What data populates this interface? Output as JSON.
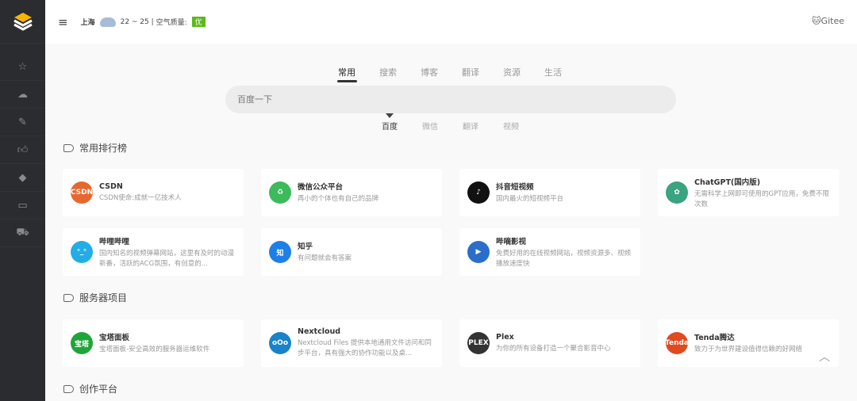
{
  "header": {
    "menu_icon": "hamburger-icon",
    "city": "上海",
    "weather_icon": "cloud-icon",
    "temp": "22 ~ 25",
    "sep": "|",
    "aq_label": "空气质量:",
    "aq_value": "优",
    "gitee": "🐱Gitee"
  },
  "sidebar": {
    "items": [
      "star-icon",
      "cloud-icon",
      "pencil-icon",
      "thumbs-up-icon",
      "diamond-icon",
      "monitor-icon",
      "truck-icon"
    ]
  },
  "tabs": [
    "常用",
    "搜索",
    "博客",
    "翻译",
    "资源",
    "生活"
  ],
  "search": {
    "placeholder": "百度一下"
  },
  "engines": [
    "百度",
    "微信",
    "翻译",
    "视频"
  ],
  "sections": [
    {
      "title": "常用排行榜",
      "cards": [
        {
          "title": "CSDN",
          "desc": "CSDN使命:成就一亿技术人",
          "icon": "CSDN",
          "color": "#e8672f"
        },
        {
          "title": "微信公众平台",
          "desc": "再小的个体也有自己的品牌",
          "icon": "♻",
          "color": "#3cba5c"
        },
        {
          "title": "抖音短视频",
          "desc": "国内最火的短视频平台",
          "icon": "♪",
          "color": "#111111"
        },
        {
          "title": "ChatGPT(国内版)",
          "desc": "无需科学上网即可使用的GPT应用，免费不限次数",
          "icon": "✿",
          "color": "#3aa37f"
        },
        {
          "title": "哔哩哔哩",
          "desc": "国内知名的视频弹幕网站，这里有及时的动漫新番，活跃的ACG氛围，有创意的...",
          "icon": "ᐢ_ᐢ",
          "color": "#23ade5"
        },
        {
          "title": "知乎",
          "desc": "有问题就会有答案",
          "icon": "知",
          "color": "#1e80e6"
        },
        {
          "title": "哔嘀影视",
          "desc": "免费好用的在线视频网站，视频资源多、视频播放速度快",
          "icon": "▶",
          "color": "#2a6ec9"
        }
      ]
    },
    {
      "title": "服务器项目",
      "cards": [
        {
          "title": "宝塔面板",
          "desc": "宝塔面板-安全高效的服务器运维软件",
          "icon": "宝塔",
          "color": "#20a53a"
        },
        {
          "title": "Nextcloud",
          "desc": "Nextcloud Files 提供本地通用文件访问和同步平台，具有强大的协作功能以及桌...",
          "icon": "oOo",
          "color": "#1a82c8"
        },
        {
          "title": "Plex",
          "desc": "为你的所有设备打造一个聚合影音中心",
          "icon": "PLEX",
          "color": "#333333"
        },
        {
          "title": "Tenda腾达",
          "desc": "致力于为世界建设值得信赖的好网络",
          "icon": "Tenda",
          "color": "#e04a1f"
        }
      ]
    },
    {
      "title": "创作平台",
      "cards": []
    }
  ]
}
